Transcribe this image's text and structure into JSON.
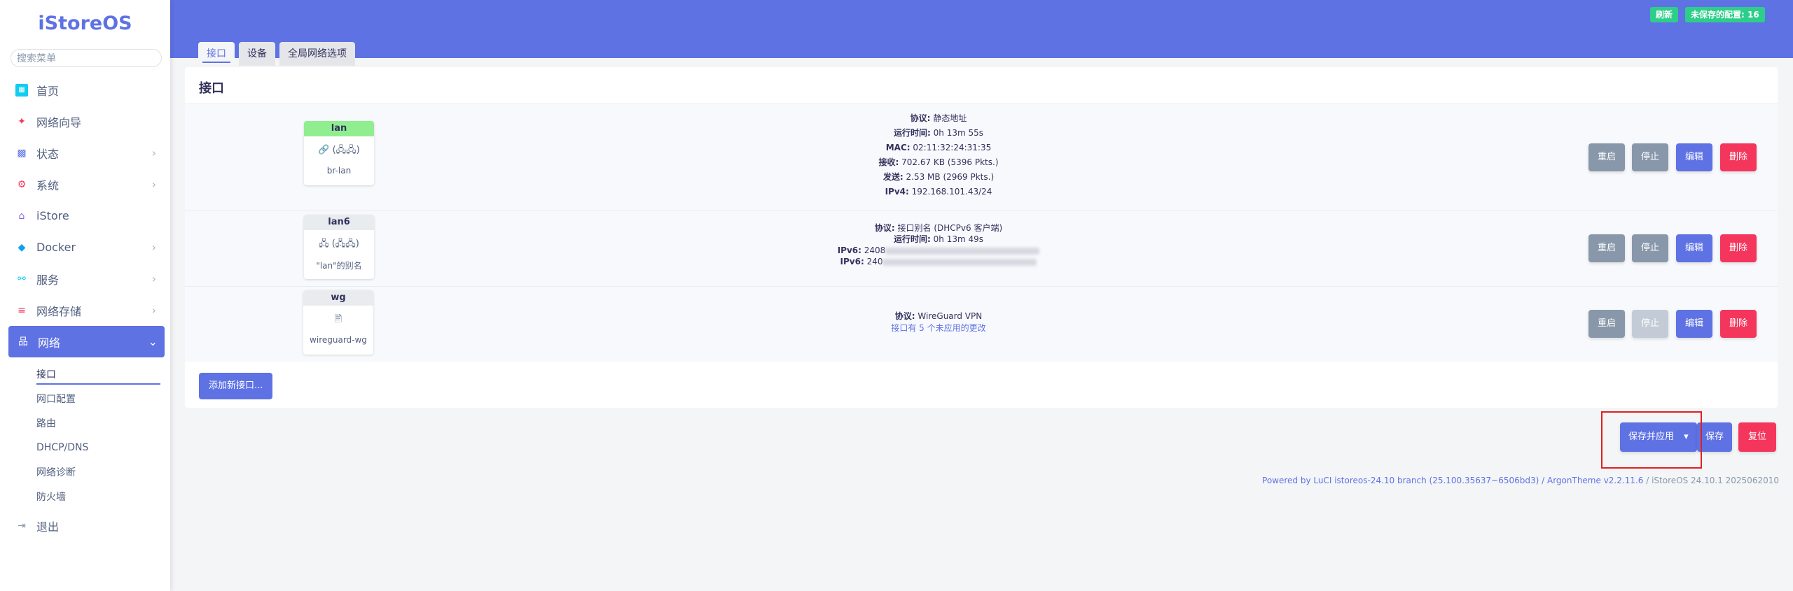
{
  "app": {
    "logo": "iStoreOS"
  },
  "sidebar": {
    "search_placeholder": "搜索菜单",
    "items": [
      {
        "label": "首页",
        "icon": "home-icon"
      },
      {
        "label": "网络向导",
        "icon": "wizard-icon"
      },
      {
        "label": "状态",
        "icon": "dashboard-icon"
      },
      {
        "label": "系统",
        "icon": "gear-icon"
      },
      {
        "label": "iStore",
        "icon": "store-icon"
      },
      {
        "label": "Docker",
        "icon": "docker-icon"
      },
      {
        "label": "服务",
        "icon": "services-icon"
      },
      {
        "label": "网络存储",
        "icon": "storage-icon"
      },
      {
        "label": "网络",
        "icon": "network-icon"
      }
    ],
    "sub_items": [
      "接口",
      "网口配置",
      "路由",
      "DHCP/DNS",
      "网络诊断",
      "防火墙"
    ],
    "logout": "退出"
  },
  "topbar": {
    "refresh": "刷新",
    "unsaved": "未保存的配置: 16"
  },
  "tabs": [
    "接口",
    "设备",
    "全局网络选项"
  ],
  "card": {
    "title": "接口"
  },
  "interfaces": [
    {
      "name": "lan",
      "icons": "🔗 (🖧🖧)",
      "device": "br-lan",
      "lines": [
        [
          "协议:",
          "静态地址"
        ],
        [
          "运行时间:",
          "0h 13m 55s"
        ],
        [
          "MAC:",
          "02:11:32:24:31:35"
        ],
        [
          "接收:",
          "702.67 KB (5396 Pkts.)"
        ],
        [
          "发送:",
          "2.53 MB (2969 Pkts.)"
        ],
        [
          "IPv4:",
          "192.168.101.43/24"
        ]
      ]
    },
    {
      "name": "lan6",
      "icons": "🖧 (🖧🖧)",
      "device": "\"lan\"的别名",
      "lines": [
        [
          "协议:",
          "接口别名 (DHCPv6 客户端)"
        ],
        [
          "运行时间:",
          "0h 13m 49s"
        ],
        [
          "IPv6:",
          "2408"
        ],
        [
          "IPv6:",
          "240"
        ]
      ]
    },
    {
      "name": "wg",
      "icons": "🖹",
      "device": "wireguard-wg",
      "lines": [
        [
          "协议:",
          "WireGuard VPN"
        ]
      ],
      "note": "接口有 5 个未应用的更改"
    }
  ],
  "row_buttons": {
    "restart": "重启",
    "stop": "停止",
    "edit": "编辑",
    "delete": "删除"
  },
  "add_interface": "添加新接口...",
  "actions": {
    "save_apply": "保存并应用",
    "save_apply_caret": "▾",
    "save": "保存",
    "reset": "复位"
  },
  "footer": {
    "link": "Powered by LuCI istoreos-24.10 branch (25.100.35637~6506bd3) / ArgonTheme v2.2.11.6",
    "sep": " / ",
    "version": "iStoreOS 24.10.1 2025062010"
  },
  "colors": {
    "accent": "#5e72e4",
    "danger": "#f5365c",
    "success": "#2dce89",
    "muted": "#8898aa"
  }
}
